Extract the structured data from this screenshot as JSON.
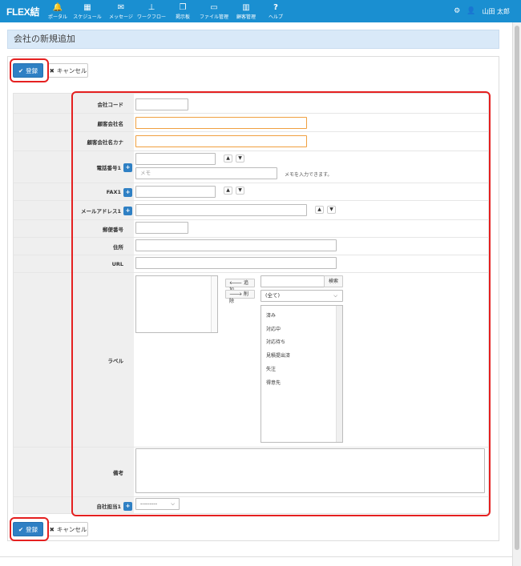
{
  "app": {
    "logo": "FLEX結"
  },
  "nav": {
    "items": [
      {
        "label": "ポータル",
        "icon": "bell-icon",
        "glyph": "🔔"
      },
      {
        "label": "スケジュール",
        "icon": "calendar-icon",
        "glyph": "▦"
      },
      {
        "label": "メッセージ",
        "icon": "envelope-icon",
        "glyph": "✉"
      },
      {
        "label": "ワークフロー",
        "icon": "stamp-icon",
        "glyph": "⊥"
      },
      {
        "label": "掲示板",
        "icon": "board-icon",
        "glyph": "❐"
      },
      {
        "label": "ファイル管理",
        "icon": "drive-icon",
        "glyph": "▭"
      },
      {
        "label": "顧客管理",
        "icon": "building-icon",
        "glyph": "▥"
      },
      {
        "label": "ヘルプ",
        "icon": "question-icon",
        "glyph": "?"
      }
    ],
    "user": "山田 太郎"
  },
  "page": {
    "title": "会社の新規追加"
  },
  "buttons": {
    "register": "登録",
    "cancel": "キャンセル"
  },
  "form": {
    "company_code": "会社コード",
    "client_name": "顧客会社名",
    "client_kana": "顧客会社名カナ",
    "phone": "電話番号1",
    "memo_placeholder": "メモ",
    "memo_hint": "メモを入力できます。",
    "fax": "FAX1",
    "email": "メールアドレス1",
    "zip": "郵便番号",
    "address": "住所",
    "url": "URL",
    "label": "ラベル",
    "add": "追加",
    "remove": "削除",
    "search": "検索",
    "filter_selected": "(全て)",
    "label_options": [
      "済み",
      "対応中",
      "対応待ち",
      "見積提出済",
      "失注",
      "得意先"
    ],
    "notes": "備考",
    "owner": "自社担当1",
    "owner_selected": "---------"
  },
  "colors": {
    "nav": "#1a8fd1",
    "primary": "#2f80c4",
    "required_border": "#f0a040",
    "highlight": "#e52020"
  }
}
